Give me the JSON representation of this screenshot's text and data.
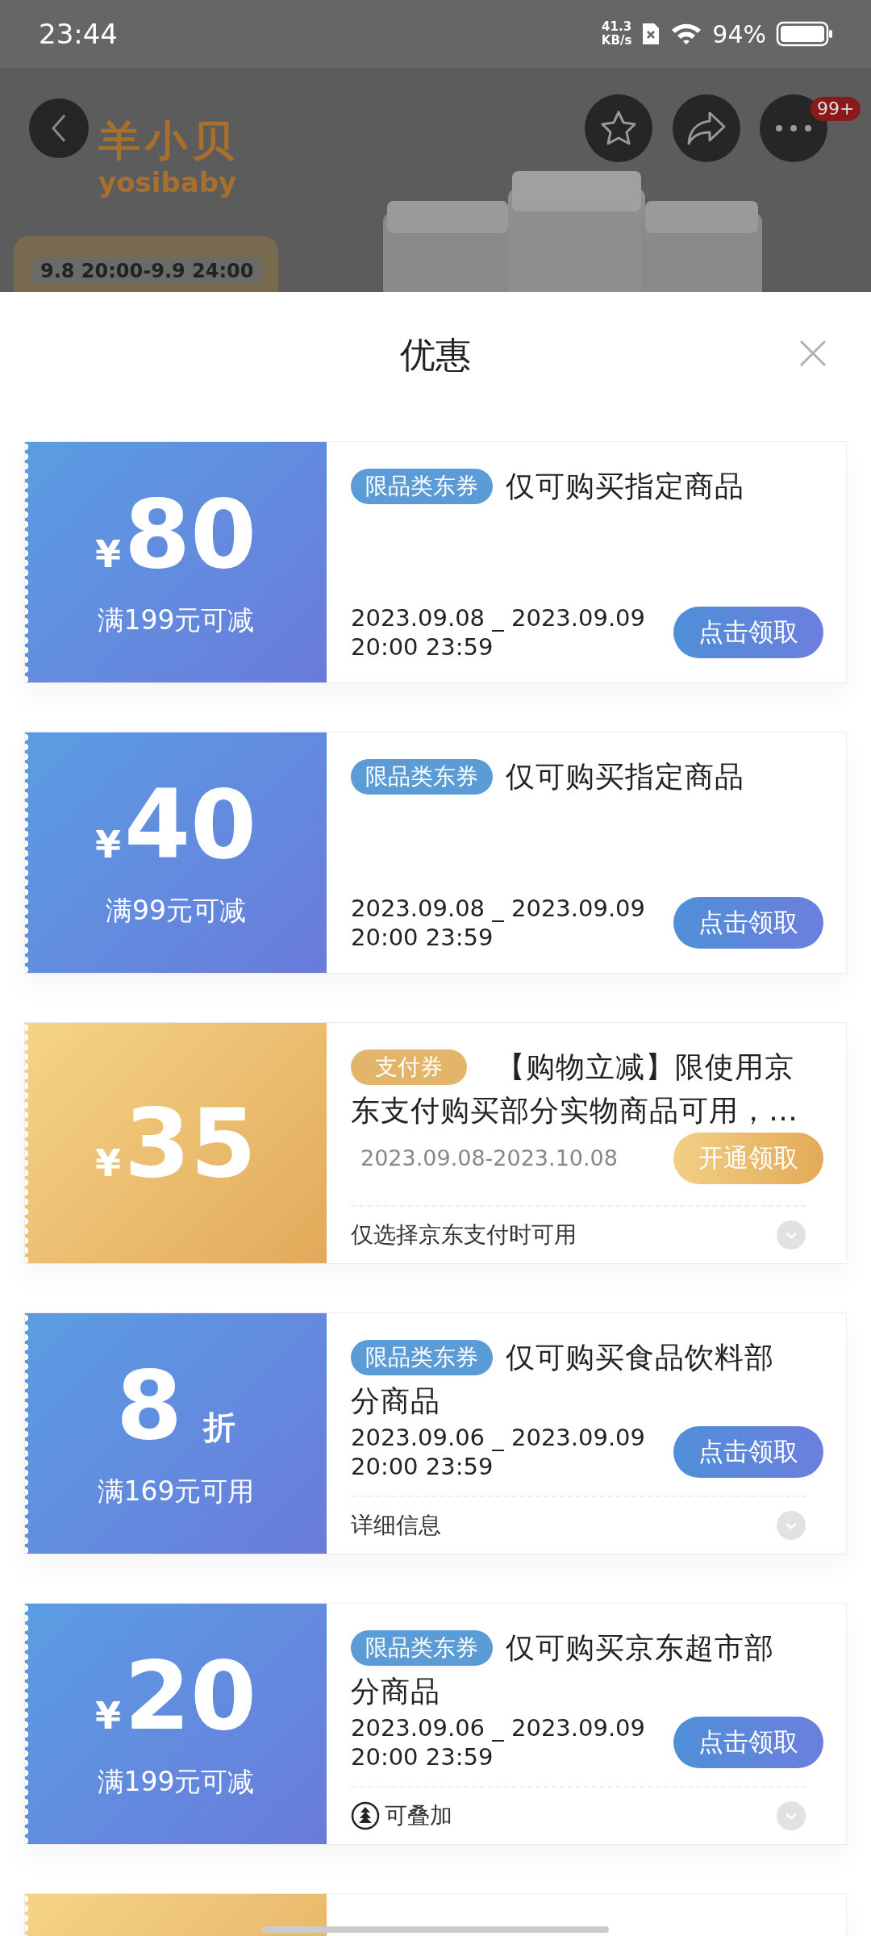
{
  "status_bar": {
    "time": "23:44",
    "net_speed": "41.3",
    "net_unit": "KB/s",
    "battery": "94%"
  },
  "header": {
    "logo_cn": "羊小贝",
    "logo_en": "yosibaby",
    "promo_time": "9.8 20:00-9.9 24:00",
    "badge": "99+"
  },
  "sheet": {
    "title": "优惠"
  },
  "coupons": [
    {
      "kind": "blue",
      "currency": "¥",
      "amount": "80",
      "condition": "满199元可减",
      "tag": "限品类东券",
      "title_lines": [
        "仅可购买指定商品"
      ],
      "dates": [
        "2023.09.08 _ 2023.09.09",
        "20:00 23:59"
      ],
      "button": "点击领取"
    },
    {
      "kind": "blue",
      "currency": "¥",
      "amount": "40",
      "condition": "满99元可减",
      "tag": "限品类东券",
      "title_lines": [
        "仅可购买指定商品"
      ],
      "dates": [
        "2023.09.08 _ 2023.09.09",
        "20:00 23:59"
      ],
      "button": "点击领取"
    },
    {
      "kind": "gold",
      "currency": "¥",
      "amount": "35",
      "tag": "支付券",
      "title_lines": [
        "【购物立减】限使用京",
        "东支付购买部分实物商品可用，…"
      ],
      "dates": [
        "2023.09.08-2023.10.08"
      ],
      "button": "开通领取",
      "footer": {
        "kind": "plain",
        "text": "仅选择京东支付时可用"
      }
    },
    {
      "kind": "blue",
      "amount": "8",
      "suffix": "折",
      "condition": "满169元可用",
      "tag": "限品类东券",
      "title_lines": [
        "仅可购买食品饮料部",
        "分商品"
      ],
      "dates": [
        "2023.09.06 _ 2023.09.09",
        "20:00 23:59"
      ],
      "button": "点击领取",
      "footer": {
        "kind": "plain",
        "text": "详细信息"
      }
    },
    {
      "kind": "blue",
      "currency": "¥",
      "amount": "20",
      "condition": "满199元可减",
      "tag": "限品类东券",
      "title_lines": [
        "仅可购买京东超市部",
        "分商品"
      ],
      "dates": [
        "2023.09.06 _ 2023.09.09",
        "20:00 23:59"
      ],
      "button": "点击领取",
      "footer": {
        "kind": "stackable",
        "text": "可叠加"
      }
    },
    {
      "kind": "gold"
    }
  ]
}
